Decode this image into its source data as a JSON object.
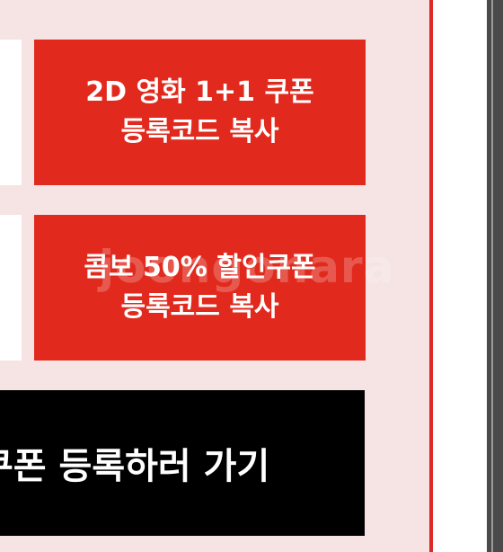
{
  "buttons": {
    "movie_coupon": {
      "line1": "2D 영화 1+1 쿠폰",
      "line2": "등록코드 복사"
    },
    "combo_coupon": {
      "line1": "콤보 50% 할인쿠폰",
      "line2": "등록코드 복사"
    },
    "register": {
      "label": "쿠폰 등록하러 가기"
    }
  },
  "watermark": {
    "text": "joongonara"
  },
  "colors": {
    "accent_red": "#e12a1d",
    "background": "#f6e3e3",
    "black_button": "#000000"
  }
}
